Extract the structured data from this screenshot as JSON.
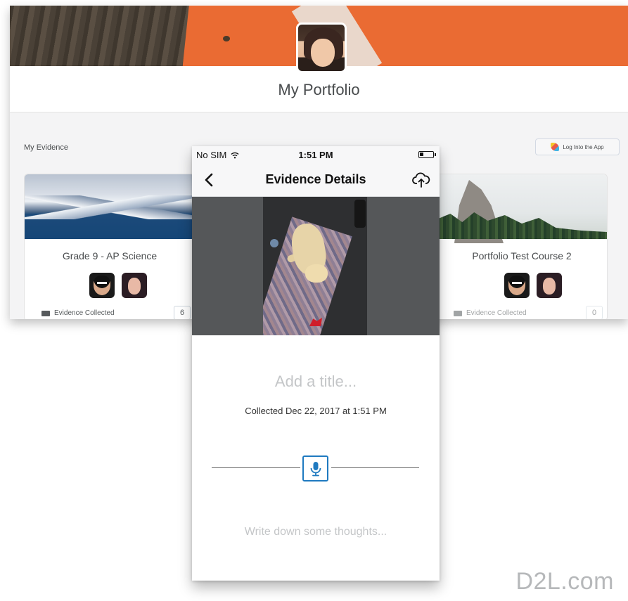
{
  "portfolio": {
    "title": "My Portfolio",
    "section_label": "My Evidence",
    "log_button_label": "Log Into the App",
    "courses": [
      {
        "name": "Grade 9 - AP Science",
        "evidence_label": "Evidence Collected",
        "evidence_count": "6"
      },
      {
        "name": "Portfolio Test Course 2",
        "evidence_label": "Evidence Collected",
        "evidence_count": "0"
      }
    ]
  },
  "phone": {
    "status": {
      "carrier": "No SIM",
      "time": "1:51 PM"
    },
    "navbar": {
      "title": "Evidence Details",
      "back_icon": "chevron-left-icon",
      "upload_icon": "cloud-upload-icon"
    },
    "title_placeholder": "Add a title...",
    "collected_text": "Collected Dec 22, 2017 at 1:51 PM",
    "mic_icon": "microphone-icon",
    "thoughts_placeholder": "Write down some thoughts..."
  },
  "watermark": "D2L.com",
  "colors": {
    "accent": "#1f7ac0",
    "banner_orange": "#ea6b33"
  }
}
